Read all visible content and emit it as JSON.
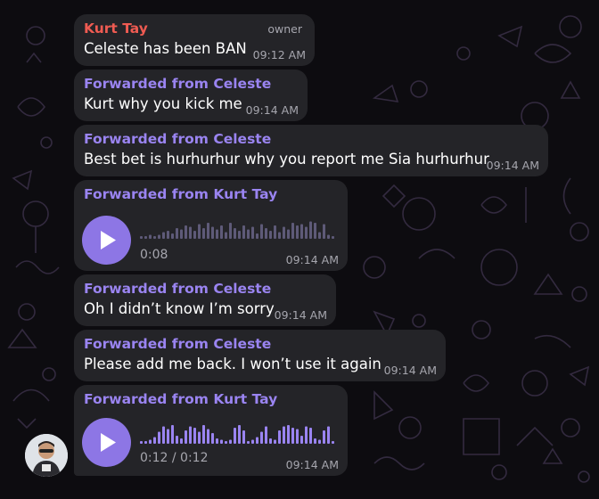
{
  "chat": {
    "messages": [
      {
        "sender": "Kurt Tay",
        "badge": "owner",
        "text": "Celeste has been BAN",
        "time": "09:12 AM"
      },
      {
        "sender": "Forwarded from Celeste",
        "text": "Kurt why you kick me",
        "time": "09:14 AM"
      },
      {
        "sender": "Forwarded from Celeste",
        "text": "Best bet is hurhurhur why you report me Sia hurhurhur",
        "time": "09:14 AM"
      },
      {
        "sender": "Forwarded from Kurt Tay",
        "voice_duration": "0:08",
        "time": "09:14 AM"
      },
      {
        "sender": "Forwarded from Celeste",
        "text": "Oh I didn’t know I’m sorry",
        "time": "09:14 AM"
      },
      {
        "sender": "Forwarded from Celeste",
        "text": "Please add me back. I won’t use it again",
        "time": "09:14 AM"
      },
      {
        "sender": "Forwarded from Kurt Tay",
        "voice_duration": "0:12 / 0:12",
        "time": "09:14 AM"
      }
    ]
  },
  "voice_playback": [
    {
      "played_fraction": 0.0
    },
    {
      "played_fraction": 1.0
    }
  ],
  "icons": {
    "play": "play-icon",
    "avatar": "user-avatar"
  },
  "colors": {
    "background": "#0d0c10",
    "bubble": "#242428",
    "forwarded_name": "#9a84f1",
    "owner_name": "#ef5b52",
    "play_button": "#8d76e5",
    "wave_played": "#9a84f1",
    "wave_unplayed": "#5e5a78",
    "timestamp": "#a6a6ae"
  }
}
